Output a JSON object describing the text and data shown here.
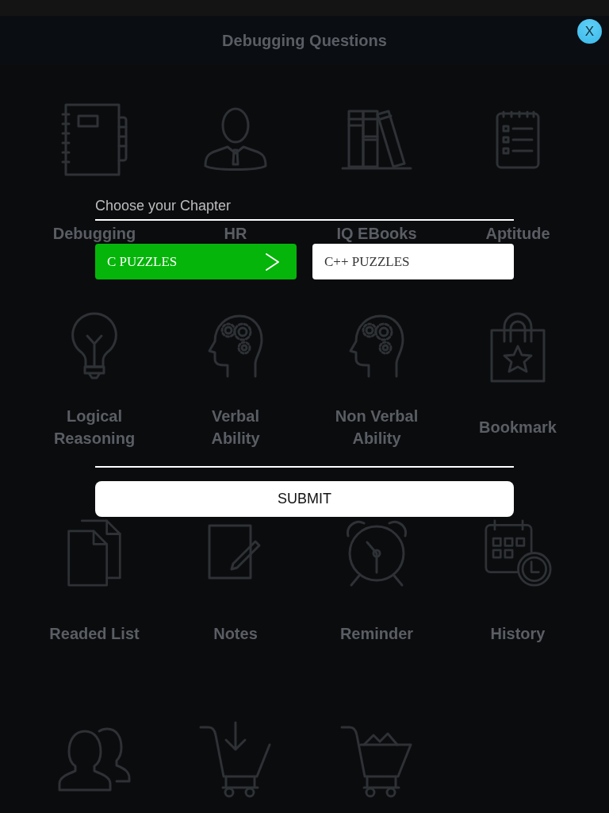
{
  "background_page": {
    "title": "Debugging Questions",
    "tiles": [
      {
        "label": "Debugging"
      },
      {
        "label": "HR"
      },
      {
        "label": "IQ EBooks"
      },
      {
        "label": "Aptitude"
      },
      {
        "label": "Logical Reasoning"
      },
      {
        "label": "Verbal Ability"
      },
      {
        "label": "Non Verbal Ability"
      },
      {
        "label": "Bookmark"
      },
      {
        "label": "Readed List"
      },
      {
        "label": "Notes"
      },
      {
        "label": "Reminder"
      },
      {
        "label": "History"
      }
    ]
  },
  "chapter_dialog": {
    "title": "Choose your Chapter",
    "options": [
      {
        "label": "C PUZZLES",
        "selected": true
      },
      {
        "label": "C++ PUZZLES",
        "selected": false
      }
    ],
    "submit": "SUBMIT",
    "close": "X"
  }
}
